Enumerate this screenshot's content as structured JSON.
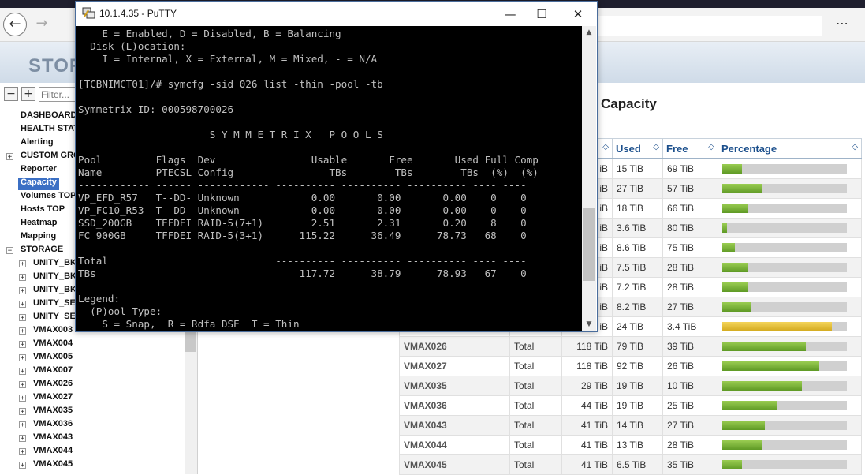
{
  "app": {
    "logo": "STOR",
    "filter_placeholder": "Filter...",
    "page_title": "Capacity"
  },
  "sidebar": {
    "collapse_label": "−",
    "expand_label": "+",
    "items": [
      {
        "label": "DASHBOARD",
        "level": 0,
        "expandable": false,
        "selected": false
      },
      {
        "label": "HEALTH STAT",
        "level": 0,
        "expandable": false,
        "selected": false
      },
      {
        "label": "Alerting",
        "level": 0,
        "expandable": false,
        "selected": false
      },
      {
        "label": "CUSTOM GRO",
        "level": 0,
        "expandable": true,
        "selected": false
      },
      {
        "label": "Reporter",
        "level": 0,
        "expandable": false,
        "selected": false
      },
      {
        "label": "Capacity",
        "level": 0,
        "expandable": false,
        "selected": true
      },
      {
        "label": "Volumes TOP",
        "level": 0,
        "expandable": false,
        "selected": false
      },
      {
        "label": "Hosts TOP",
        "level": 0,
        "expandable": false,
        "selected": false
      },
      {
        "label": "Heatmap",
        "level": 0,
        "expandable": false,
        "selected": false
      },
      {
        "label": "Mapping",
        "level": 0,
        "expandable": false,
        "selected": false
      },
      {
        "label": "STORAGE",
        "level": 0,
        "expandable": true,
        "selected": false,
        "collapse": true
      },
      {
        "label": "UNITY_BK",
        "level": 1,
        "expandable": true,
        "selected": false
      },
      {
        "label": "UNITY_BK",
        "level": 1,
        "expandable": true,
        "selected": false
      },
      {
        "label": "UNITY_BK",
        "level": 1,
        "expandable": true,
        "selected": false
      },
      {
        "label": "UNITY_SE",
        "level": 1,
        "expandable": true,
        "selected": false
      },
      {
        "label": "UNITY_SE",
        "level": 1,
        "expandable": true,
        "selected": false
      },
      {
        "label": "VMAX003",
        "level": 1,
        "expandable": true,
        "selected": false
      },
      {
        "label": "VMAX004",
        "level": 1,
        "expandable": true,
        "selected": false
      },
      {
        "label": "VMAX005",
        "level": 1,
        "expandable": true,
        "selected": false
      },
      {
        "label": "VMAX007",
        "level": 1,
        "expandable": true,
        "selected": false
      },
      {
        "label": "VMAX026",
        "level": 1,
        "expandable": true,
        "selected": false
      },
      {
        "label": "VMAX027",
        "level": 1,
        "expandable": true,
        "selected": false
      },
      {
        "label": "VMAX035",
        "level": 1,
        "expandable": true,
        "selected": false
      },
      {
        "label": "VMAX036",
        "level": 1,
        "expandable": true,
        "selected": false
      },
      {
        "label": "VMAX043",
        "level": 1,
        "expandable": true,
        "selected": false
      },
      {
        "label": "VMAX044",
        "level": 1,
        "expandable": true,
        "selected": false
      },
      {
        "label": "VMAX045",
        "level": 1,
        "expandable": true,
        "selected": false
      }
    ]
  },
  "table": {
    "columns": [
      "",
      "",
      "",
      "Used",
      "Free",
      "Percentage"
    ],
    "rows": [
      {
        "name": "",
        "type": "",
        "total": "iB",
        "used": "15 TiB",
        "free": "69 TiB",
        "pct": 16,
        "warn": false
      },
      {
        "name": "",
        "type": "",
        "total": "iB",
        "used": "27 TiB",
        "free": "57 TiB",
        "pct": 32,
        "warn": false
      },
      {
        "name": "",
        "type": "",
        "total": "iB",
        "used": "18 TiB",
        "free": "66 TiB",
        "pct": 21,
        "warn": false
      },
      {
        "name": "",
        "type": "",
        "total": "iB",
        "used": "3.6 TiB",
        "free": "80 TiB",
        "pct": 4,
        "warn": false
      },
      {
        "name": "",
        "type": "",
        "total": "iB",
        "used": "8.6 TiB",
        "free": "75 TiB",
        "pct": 10,
        "warn": false
      },
      {
        "name": "",
        "type": "",
        "total": "iB",
        "used": "7.5 TiB",
        "free": "28 TiB",
        "pct": 21,
        "warn": false
      },
      {
        "name": "",
        "type": "",
        "total": "iB",
        "used": "7.2 TiB",
        "free": "28 TiB",
        "pct": 20,
        "warn": false
      },
      {
        "name": "",
        "type": "",
        "total": "iB",
        "used": "8.2 TiB",
        "free": "27 TiB",
        "pct": 23,
        "warn": false
      },
      {
        "name": "",
        "type": "",
        "total": "iB",
        "used": "24 TiB",
        "free": "3.4 TiB",
        "pct": 88,
        "warn": true
      },
      {
        "name": "VMAX026",
        "type": "Total",
        "total": "118 TiB",
        "used": "79 TiB",
        "free": "39 TiB",
        "pct": 67,
        "warn": false
      },
      {
        "name": "VMAX027",
        "type": "Total",
        "total": "118 TiB",
        "used": "92 TiB",
        "free": "26 TiB",
        "pct": 78,
        "warn": false
      },
      {
        "name": "VMAX035",
        "type": "Total",
        "total": "29 TiB",
        "used": "19 TiB",
        "free": "10 TiB",
        "pct": 64,
        "warn": false
      },
      {
        "name": "VMAX036",
        "type": "Total",
        "total": "44 TiB",
        "used": "19 TiB",
        "free": "25 TiB",
        "pct": 44,
        "warn": false
      },
      {
        "name": "VMAX043",
        "type": "Total",
        "total": "41 TiB",
        "used": "14 TiB",
        "free": "27 TiB",
        "pct": 34,
        "warn": false
      },
      {
        "name": "VMAX044",
        "type": "Total",
        "total": "41 TiB",
        "used": "13 TiB",
        "free": "28 TiB",
        "pct": 32,
        "warn": false
      },
      {
        "name": "VMAX045",
        "type": "Total",
        "total": "41 TiB",
        "used": "6.5 TiB",
        "free": "35 TiB",
        "pct": 16,
        "warn": false
      }
    ]
  },
  "putty": {
    "title": "10.1.4.35 - PuTTY",
    "terminal_text": "    E = Enabled, D = Disabled, B = Balancing\n  Disk (L)ocation:\n    I = Internal, X = External, M = Mixed, - = N/A\n\n[TCBNIMCT01]/# symcfg -sid 026 list -thin -pool -tb\n\nSymmetrix ID: 000598700026\n\n                      S Y M M E T R I X   P O O L S\n-------------------------------------------------------------------------\nPool         Flags  Dev                Usable       Free       Used Full Comp\nName         PTECSL Config                TBs        TBs        TBs  (%)  (%)\n------------ ------ ------------ ---------- ---------- ---------- ---- ----\nVP_EFD_R57   T--DD- Unknown            0.00       0.00       0.00    0    0\nVP_FC10_R53  T--DD- Unknown            0.00       0.00       0.00    0    0\nSSD_200GB    TEFDEI RAID-5(7+1)        2.51       2.31       0.20    8    0\nFC_900GB     TFFDEI RAID-5(3+1)      115.22      36.49      78.73   68    0\n\nTotal                            ---------- ---------- ---------- ---- ----\nTBs                                  117.72      38.79      78.93   67    0\n\nLegend:\n  (P)ool Type:\n    S = Snap,  R = Rdfa DSE  T = Thin"
  }
}
